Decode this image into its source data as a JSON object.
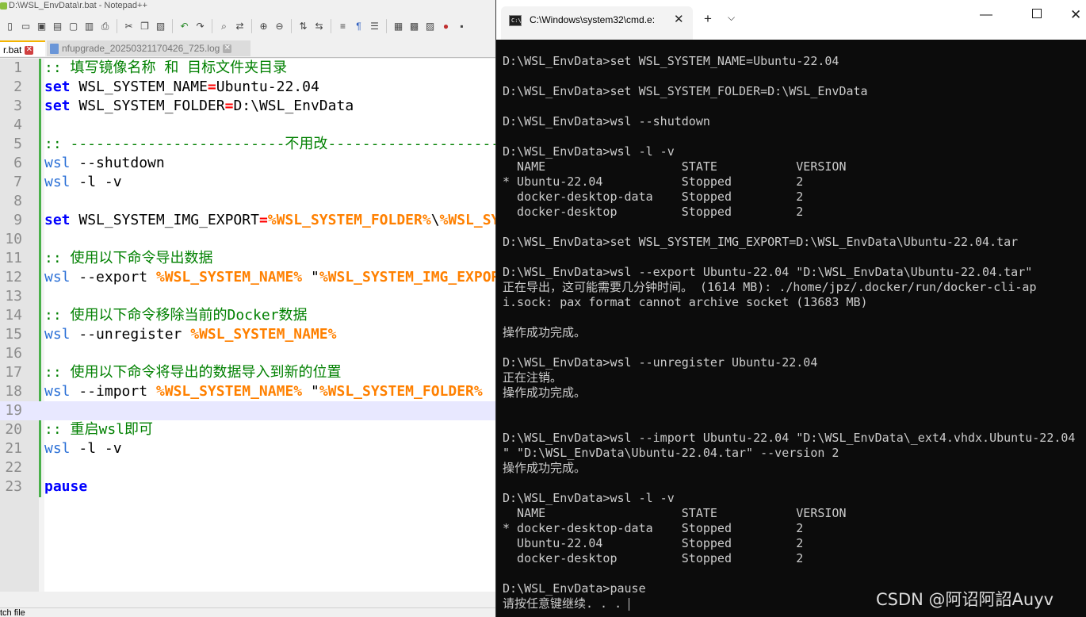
{
  "notepad": {
    "title": "D:\\WSL_EnvData\\r.bat - Notepad++",
    "toolbar_icons": [
      "new-file-icon",
      "open-file-icon",
      "save-icon",
      "save-all-icon",
      "close-icon",
      "close-all-icon",
      "print-icon",
      "cut-icon",
      "copy-icon",
      "paste-icon",
      "undo-icon",
      "redo-icon",
      "find-icon",
      "replace-icon",
      "zoom-in-icon",
      "zoom-out-icon",
      "sync-v-icon",
      "sync-h-icon",
      "wrap-icon",
      "show-all-chars-icon",
      "indent-guide-icon",
      "doc-map-icon",
      "function-list-icon",
      "folder-workspace-icon",
      "record-macro-icon",
      "macro-icon"
    ],
    "tabs": [
      {
        "label": "r.bat",
        "active": true
      },
      {
        "label": "nfupgrade_20250321170426_725.log",
        "active": false
      }
    ],
    "lines": [
      {
        "n": "1",
        "t": ":: 填写镜像名称 和 目标文件夹目录"
      },
      {
        "n": "2",
        "t": "set WSL_SYSTEM_NAME=Ubuntu-22.04"
      },
      {
        "n": "3",
        "t": "set WSL_SYSTEM_FOLDER=D:\\WSL_EnvData"
      },
      {
        "n": "4",
        "t": ""
      },
      {
        "n": "5",
        "t": ":: -------------------------不用改----------------------"
      },
      {
        "n": "6",
        "t": "wsl --shutdown"
      },
      {
        "n": "7",
        "t": "wsl -l -v"
      },
      {
        "n": "8",
        "t": ""
      },
      {
        "n": "9",
        "t": "set WSL_SYSTEM_IMG_EXPORT=%WSL_SYSTEM_FOLDER%\\%WSL_SYSTEM_NAME%.tar"
      },
      {
        "n": "10",
        "t": ""
      },
      {
        "n": "11",
        "t": ":: 使用以下命令导出数据"
      },
      {
        "n": "12",
        "t": "wsl --export %WSL_SYSTEM_NAME% \"%WSL_SYSTEM_IMG_EXPORT%\""
      },
      {
        "n": "13",
        "t": ""
      },
      {
        "n": "14",
        "t": ":: 使用以下命令移除当前的Docker数据"
      },
      {
        "n": "15",
        "t": "wsl --unregister %WSL_SYSTEM_NAME%"
      },
      {
        "n": "16",
        "t": ""
      },
      {
        "n": "17",
        "t": ":: 使用以下命令将导出的数据导入到新的位置"
      },
      {
        "n": "18",
        "t": "wsl --import %WSL_SYSTEM_NAME% \"%WSL_SYSTEM_FOLDER%"
      },
      {
        "n": "19",
        "t": ""
      },
      {
        "n": "20",
        "t": ":: 重启wsl即可"
      },
      {
        "n": "21",
        "t": "wsl -l -v"
      },
      {
        "n": "22",
        "t": ""
      },
      {
        "n": "23",
        "t": "pause"
      }
    ],
    "status": "tch file",
    "colors": {
      "comment": "#008000",
      "keyword": "#0000ff",
      "command": "#2a6fd6",
      "variable": "#ff8000",
      "operator": "#ff0000",
      "fold_line": "#4ab04a"
    }
  },
  "cmd": {
    "tab_title": "C:\\Windows\\system32\\cmd.e:",
    "lines": [
      "D:\\WSL_EnvData>set WSL_SYSTEM_NAME=Ubuntu-22.04",
      "",
      "D:\\WSL_EnvData>set WSL_SYSTEM_FOLDER=D:\\WSL_EnvData",
      "",
      "D:\\WSL_EnvData>wsl --shutdown",
      "",
      "D:\\WSL_EnvData>wsl -l -v",
      "  NAME                   STATE           VERSION",
      "* Ubuntu-22.04           Stopped         2",
      "  docker-desktop-data    Stopped         2",
      "  docker-desktop         Stopped         2",
      "",
      "D:\\WSL_EnvData>set WSL_SYSTEM_IMG_EXPORT=D:\\WSL_EnvData\\Ubuntu-22.04.tar",
      "",
      "D:\\WSL_EnvData>wsl --export Ubuntu-22.04 \"D:\\WSL_EnvData\\Ubuntu-22.04.tar\"",
      "正在导出，这可能需要几分钟时间。 (1614 MB): ./home/jpz/.docker/run/docker-cli-ap",
      "i.sock: pax format cannot archive socket (13683 MB)",
      "",
      "操作成功完成。",
      "",
      "D:\\WSL_EnvData>wsl --unregister Ubuntu-22.04",
      "正在注销。",
      "操作成功完成。",
      "",
      "",
      "D:\\WSL_EnvData>wsl --import Ubuntu-22.04 \"D:\\WSL_EnvData\\_ext4.vhdx.Ubuntu-22.04",
      "\" \"D:\\WSL_EnvData\\Ubuntu-22.04.tar\" --version 2",
      "操作成功完成。",
      "",
      "D:\\WSL_EnvData>wsl -l -v",
      "  NAME                   STATE           VERSION",
      "* docker-desktop-data    Stopped         2",
      "  Ubuntu-22.04           Stopped         2",
      "  docker-desktop         Stopped         2",
      "",
      "D:\\WSL_EnvData>pause",
      "请按任意键继续. . . "
    ]
  },
  "watermark": "CSDN @阿诏阿詔Auyv"
}
